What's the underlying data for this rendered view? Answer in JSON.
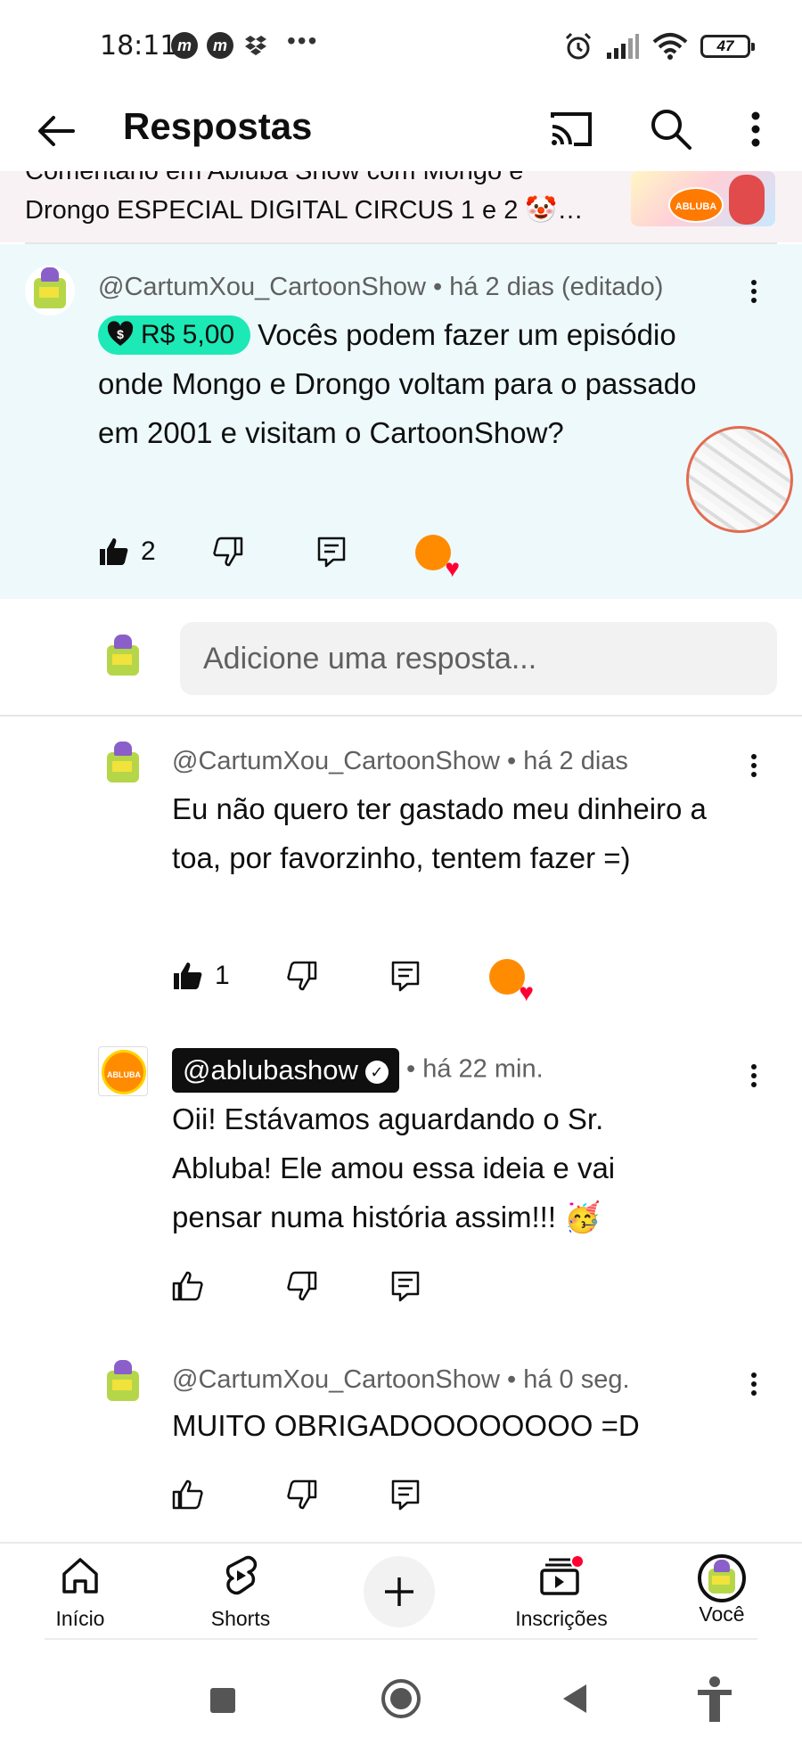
{
  "status_bar": {
    "time": "18:11",
    "app_icon_1": "m",
    "app_icon_2": "m",
    "overflow_dots": "•••",
    "battery": "47"
  },
  "app_bar": {
    "title": "Respostas"
  },
  "video": {
    "line1": "Comentário em Abluba Show com Mongo e",
    "line2": "Drongo ESPECIAL DIGITAL CIRCUS 1 e 2 🤡…"
  },
  "highlighted_comment": {
    "handle": "@CartumXou_CartoonShow",
    "time": "há 2 dias (editado)",
    "super_amount": "R$ 5,00",
    "text": "Vocês podem fazer um episódio onde Mongo e Drongo voltam para o passado em 2001 e visitam o CartoonShow?",
    "likes": "2",
    "colors": {
      "super_chat": "#1de9b6",
      "background": "#eef9fc"
    }
  },
  "reply_input": {
    "placeholder": "Adicione uma resposta..."
  },
  "replies": [
    {
      "handle": "@CartumXou_CartoonShow",
      "time": "há 2 dias",
      "text": "Eu não quero ter gastado meu dinheiro a toa, por favorzinho, tentem fazer =)",
      "likes": "1"
    },
    {
      "handle": "@ablubashow",
      "time": "há 22 min.",
      "text": "Oii! Estávamos aguardando o Sr. Abluba! Ele amou essa ideia e vai pensar numa história assim!!! 🥳",
      "likes": ""
    },
    {
      "handle": "@CartumXou_CartoonShow",
      "time": "há 0 seg.",
      "text": "MUITO OBRIGADOOOOOOOO =D",
      "likes": ""
    }
  ],
  "separator": "•",
  "bottom_nav": {
    "home": "Início",
    "shorts": "Shorts",
    "subscriptions": "Inscrições",
    "you": "Você"
  },
  "thumb_labels": {
    "video_logo": "ABLUBA SHOW",
    "channel_logo": "ABLUBA SHOW"
  }
}
